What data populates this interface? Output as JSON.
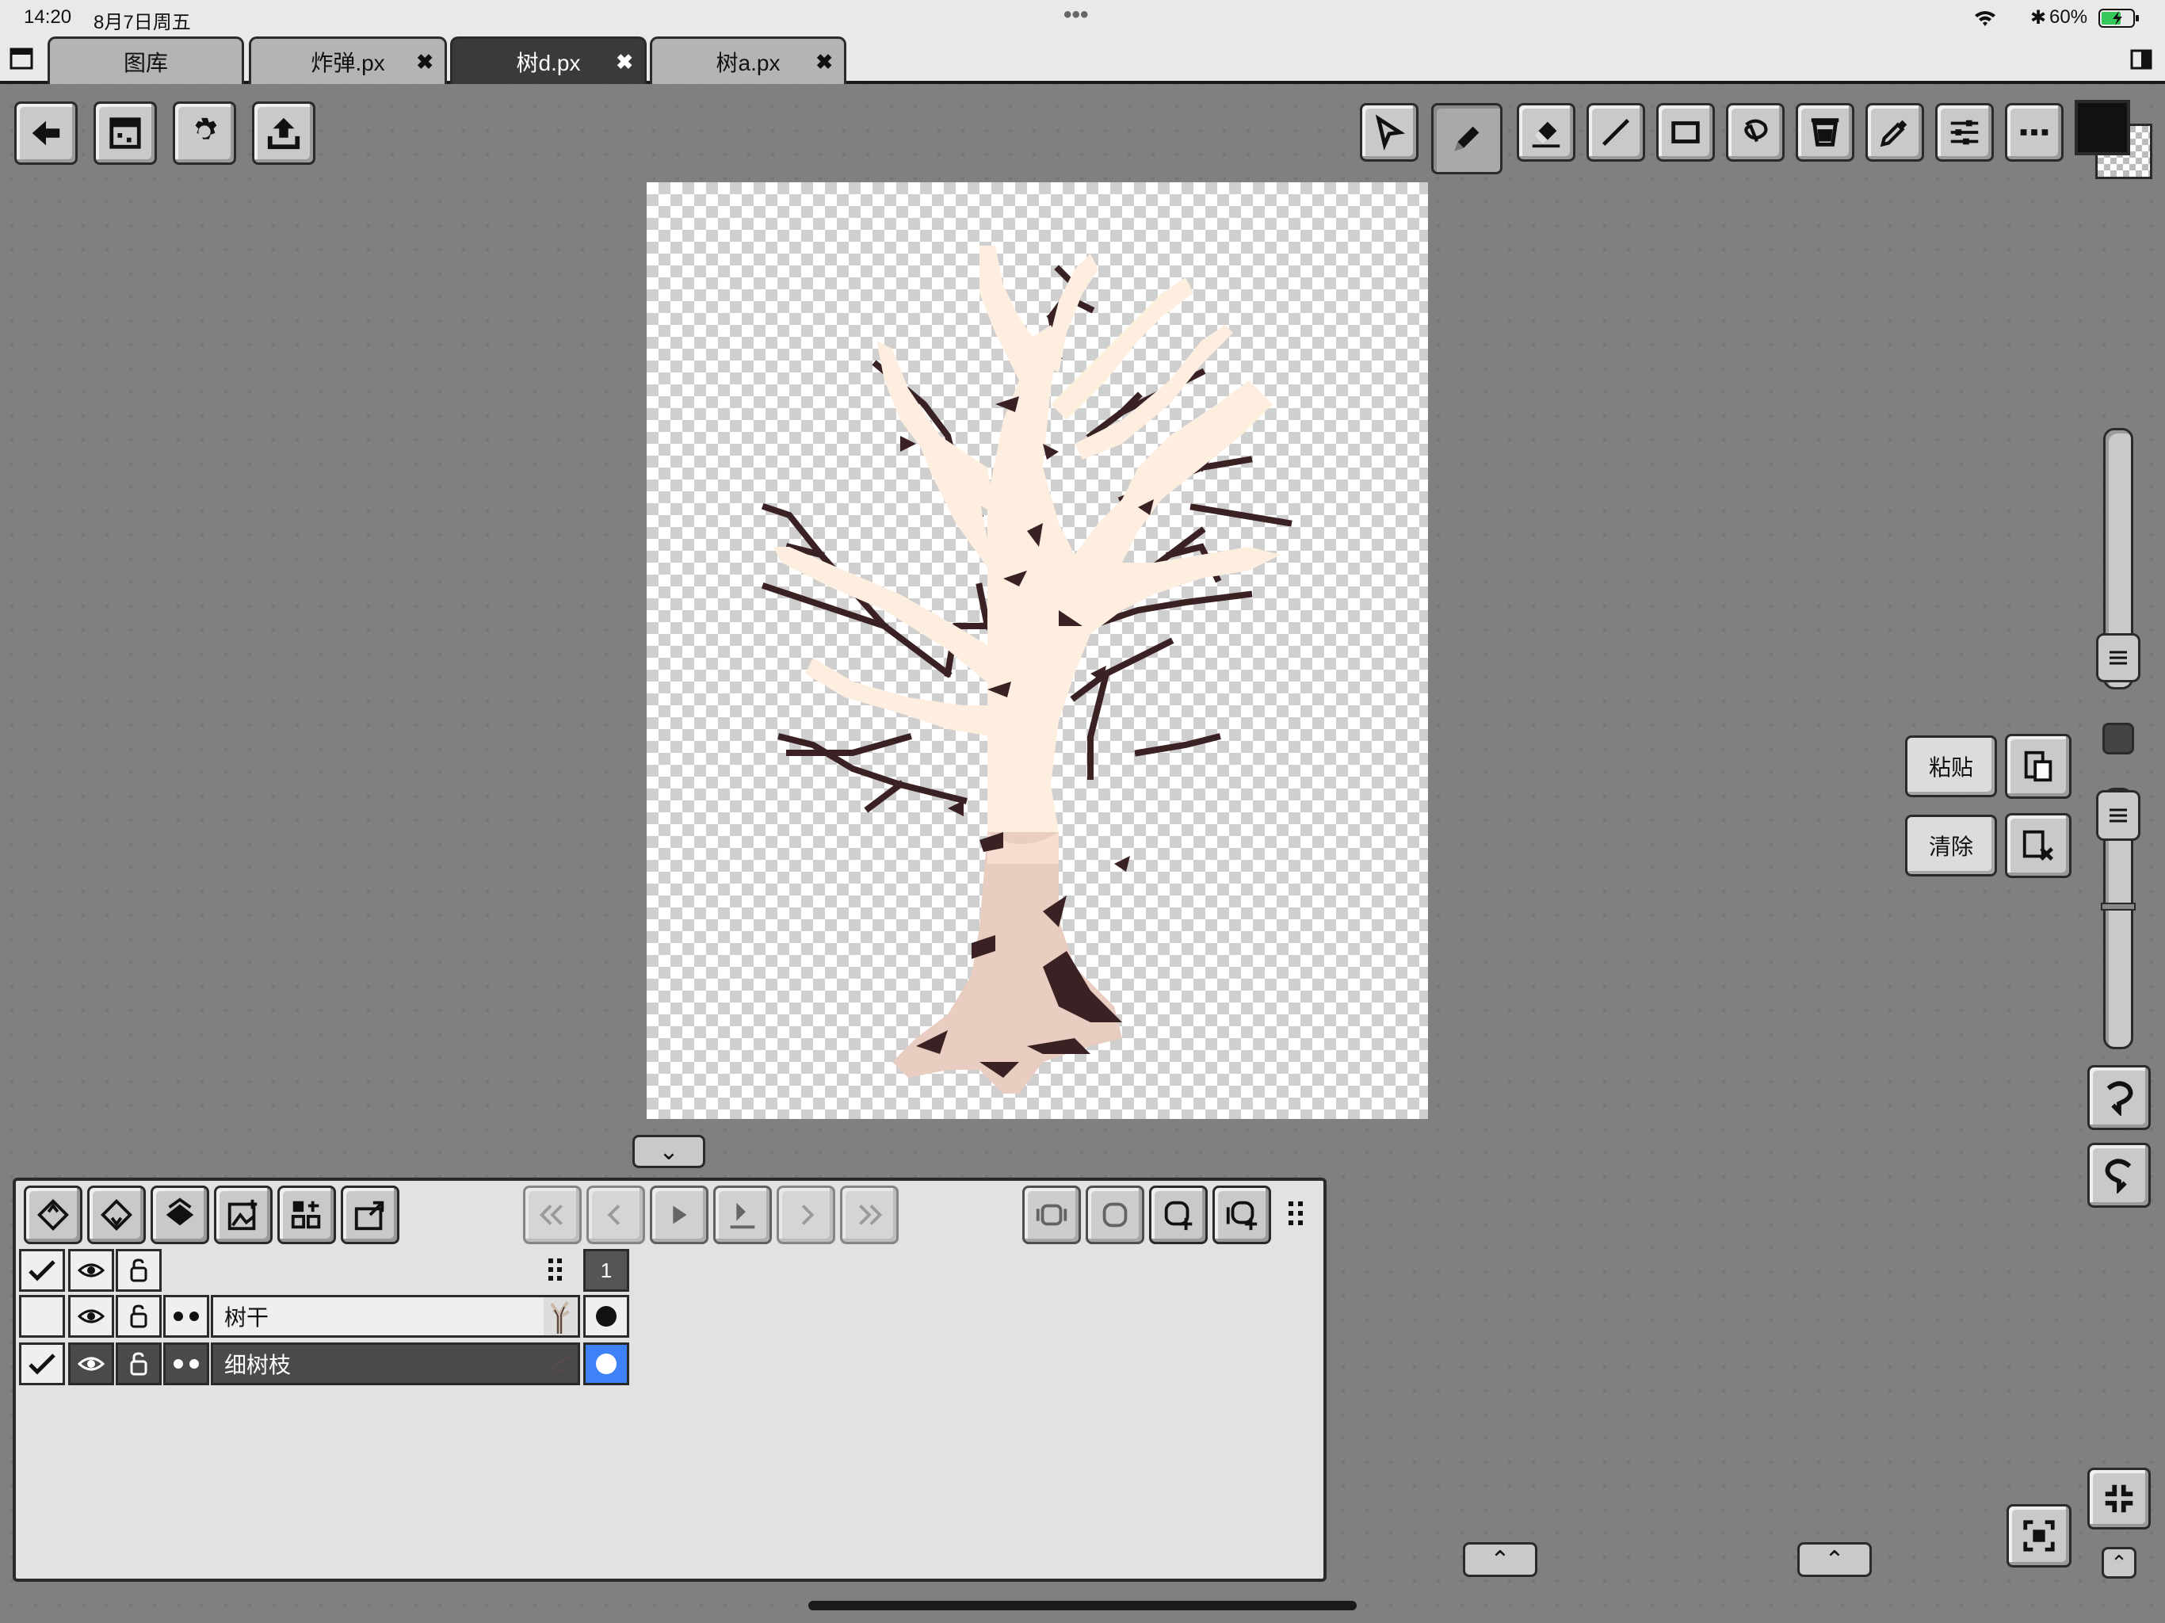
{
  "status_bar": {
    "time": "14:20",
    "date": "8月7日周五",
    "more": "•••",
    "battery": "60%"
  },
  "tabs": [
    {
      "label": "图库",
      "closable": false,
      "active": false
    },
    {
      "label": "炸弹.px",
      "closable": true,
      "active": false
    },
    {
      "label": "树d.px",
      "closable": true,
      "active": true
    },
    {
      "label": "树a.px",
      "closable": true,
      "active": false
    }
  ],
  "close_glyph": "✖",
  "left_toolbar": [
    "back-icon",
    "canvas-icon",
    "settings-icon",
    "export-icon"
  ],
  "tool_bar": [
    "select-icon",
    "pencil-icon",
    "eraser-icon",
    "line-icon",
    "rectangle-icon",
    "lasso-icon",
    "fill-bucket-icon",
    "eyedropper-icon",
    "adjust-icon",
    "more-icon"
  ],
  "colors": {
    "primary": "#111111",
    "selected_layer": "#4a4a4a",
    "layer_color_blue": "#3f82f7",
    "trunk_light": "#fdeee0",
    "bark_dark": "#3a2224"
  },
  "animation_controls": [
    "first-frame-icon",
    "prev-frame-icon",
    "play-icon",
    "onion-icon",
    "next-frame-icon",
    "last-frame-icon"
  ],
  "frame_number": "1",
  "layers": [
    {
      "name": "树干",
      "visible": true,
      "checked": false,
      "selected": false
    },
    {
      "name": "细树枝",
      "visible": true,
      "checked": true,
      "selected": true
    }
  ],
  "clipboard": {
    "paste_label": "粘贴",
    "clear_label": "清除"
  },
  "handle_glyph": "⌃",
  "collapse_glyph": "⌄"
}
